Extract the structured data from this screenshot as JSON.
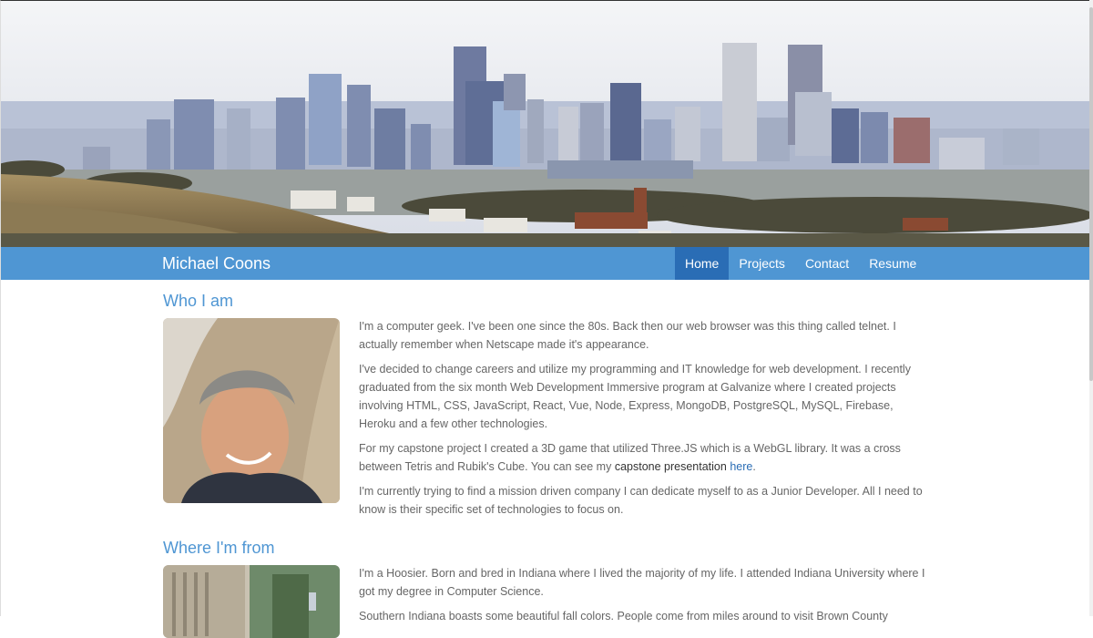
{
  "header": {
    "brand": "Michael Coons",
    "nav": [
      {
        "label": "Home",
        "active": true
      },
      {
        "label": "Projects",
        "active": false
      },
      {
        "label": "Contact",
        "active": false
      },
      {
        "label": "Resume",
        "active": false
      }
    ]
  },
  "who": {
    "title": "Who I am",
    "p1": "I'm a computer geek. I've been one since the 80s. Back then our web browser was this thing called telnet. I actually remember when Netscape made it's appearance.",
    "p2": "I've decided to change careers and utilize my programming and IT knowledge for web development. I recently graduated from the six month Web Development Immersive program at Galvanize where I created projects involving HTML, CSS, JavaScript, React, Vue, Node, Express, MongoDB, PostgreSQL, MySQL, Firebase, Heroku and a few other technologies.",
    "p3_start": "For my capstone project I created a 3D game that utilized Three.JS which is a WebGL library. It was a cross between Tetris and Rubik's Cube. You can see my ",
    "p3_highlight": "capstone presentation",
    "p3_link": "here",
    "p3_end": ".",
    "p4": "I'm currently trying to find a mission driven company I can dedicate myself to as a Junior Developer. All I need to know is their specific set of technologies to focus on."
  },
  "where": {
    "title": "Where I'm from",
    "p1": "I'm a Hoosier. Born and bred in Indiana where I lived the majority of my life. I attended Indiana University where I got my degree in Computer Science.",
    "p2": "Southern Indiana boasts some beautiful fall colors. People come from miles around to visit Brown County"
  },
  "colors": {
    "accent": "#4f96d3",
    "nav_active": "#2a6db5",
    "link": "#2a6db5"
  }
}
